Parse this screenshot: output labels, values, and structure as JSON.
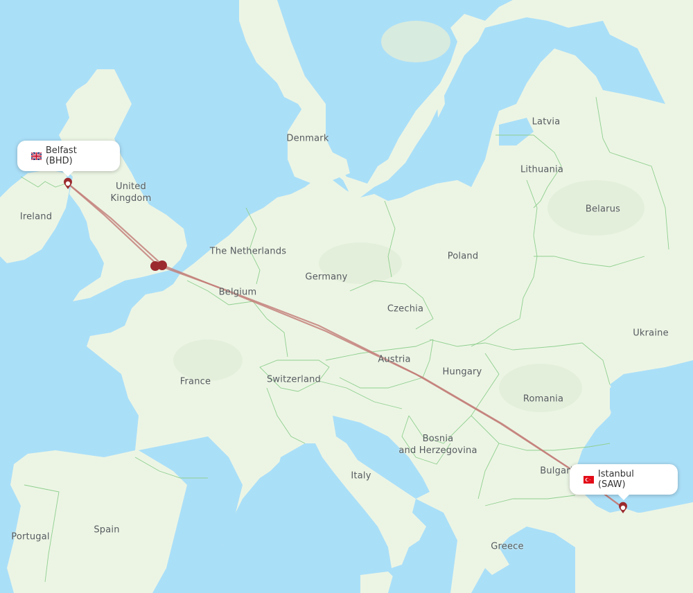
{
  "map": {
    "colors": {
      "water": "#aadff8",
      "land": "#ecf5e4",
      "land_dark": "#e2eed8",
      "border": "#8fcf8f",
      "route": "#b5605c",
      "route_light": "#d59c97",
      "marker": "#9b2a2e",
      "label": "#555a5e"
    },
    "country_labels": [
      {
        "id": "ireland",
        "text": "Ireland"
      },
      {
        "id": "united-kingdom",
        "text": "United\nKingdom"
      },
      {
        "id": "denmark",
        "text": "Denmark"
      },
      {
        "id": "latvia",
        "text": "Latvia"
      },
      {
        "id": "lithuania",
        "text": "Lithuania"
      },
      {
        "id": "belarus",
        "text": "Belarus"
      },
      {
        "id": "the-netherlands",
        "text": "The Netherlands"
      },
      {
        "id": "belgium",
        "text": "Belgium"
      },
      {
        "id": "germany",
        "text": "Germany"
      },
      {
        "id": "poland",
        "text": "Poland"
      },
      {
        "id": "czechia",
        "text": "Czechia"
      },
      {
        "id": "ukraine",
        "text": "Ukraine"
      },
      {
        "id": "france",
        "text": "France"
      },
      {
        "id": "switzerland",
        "text": "Switzerland"
      },
      {
        "id": "austria",
        "text": "Austria"
      },
      {
        "id": "hungary",
        "text": "Hungary"
      },
      {
        "id": "romania",
        "text": "Romania"
      },
      {
        "id": "bosnia-and-herzegovina",
        "text": "Bosnia\nand Herzegovina"
      },
      {
        "id": "italy",
        "text": "Italy"
      },
      {
        "id": "bulgaria",
        "text": "Bulgaria"
      },
      {
        "id": "spain",
        "text": "Spain"
      },
      {
        "id": "portugal",
        "text": "Portugal"
      },
      {
        "id": "greece",
        "text": "Greece"
      }
    ],
    "origin": {
      "city": "Belfast",
      "code": "BHD",
      "label": "Belfast (BHD)",
      "flag": "uk-flag-icon"
    },
    "destination": {
      "city": "Istanbul",
      "code": "SAW",
      "label": "Istanbul (SAW)",
      "flag": "turkey-flag-icon"
    },
    "routes": [
      {
        "id": "route-via-london-1",
        "from": "BHD",
        "via": "London",
        "to": "SAW"
      },
      {
        "id": "route-via-london-2",
        "from": "BHD",
        "via": "London",
        "to": "SAW"
      }
    ],
    "stopover_markers": [
      {
        "id": "stopover-london-a",
        "area": "London"
      },
      {
        "id": "stopover-london-b",
        "area": "London"
      }
    ]
  }
}
